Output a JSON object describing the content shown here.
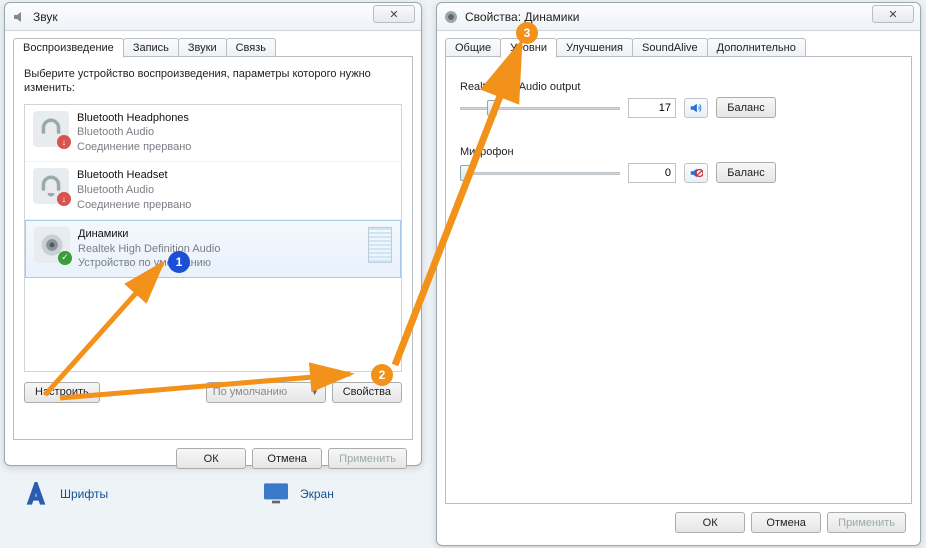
{
  "sound_window": {
    "title": "Звук",
    "tabs": [
      "Воспроизведение",
      "Запись",
      "Звуки",
      "Связь"
    ],
    "active_tab": 0,
    "instruction": "Выберите устройство воспроизведения, параметры которого нужно изменить:",
    "devices": [
      {
        "name": "Bluetooth Headphones",
        "driver": "Bluetooth Audio",
        "status": "Соединение прервано",
        "state": "error",
        "selected": false
      },
      {
        "name": "Bluetooth Headset",
        "driver": "Bluetooth Audio",
        "status": "Соединение прервано",
        "state": "error",
        "selected": false
      },
      {
        "name": "Динамики",
        "driver": "Realtek High Definition Audio",
        "status": "Устройство по умолчанию",
        "state": "default",
        "selected": true
      }
    ],
    "configure_btn": "Настроить",
    "default_dropdown": "По умолчанию",
    "properties_btn": "Свойства",
    "ok_btn": "ОК",
    "cancel_btn": "Отмена",
    "apply_btn": "Применить"
  },
  "props_window": {
    "title": "Свойства: Динамики",
    "tabs": [
      "Общие",
      "Уровни",
      "Улучшения",
      "SoundAlive",
      "Дополнительно"
    ],
    "active_tab": 1,
    "levels": [
      {
        "label": "Realtek HD Audio output",
        "value": 17,
        "pos_pct": 17,
        "muted": false
      },
      {
        "label": "Микрофон",
        "value": 0,
        "pos_pct": 0,
        "muted": true
      }
    ],
    "balance_btn": "Баланс",
    "ok_btn": "ОК",
    "cancel_btn": "Отмена",
    "apply_btn": "Применить"
  },
  "desktop_icons": {
    "fonts": "Шрифты",
    "screen": "Экран"
  },
  "annotations": {
    "a1": "1",
    "a2": "2",
    "a3": "3"
  }
}
